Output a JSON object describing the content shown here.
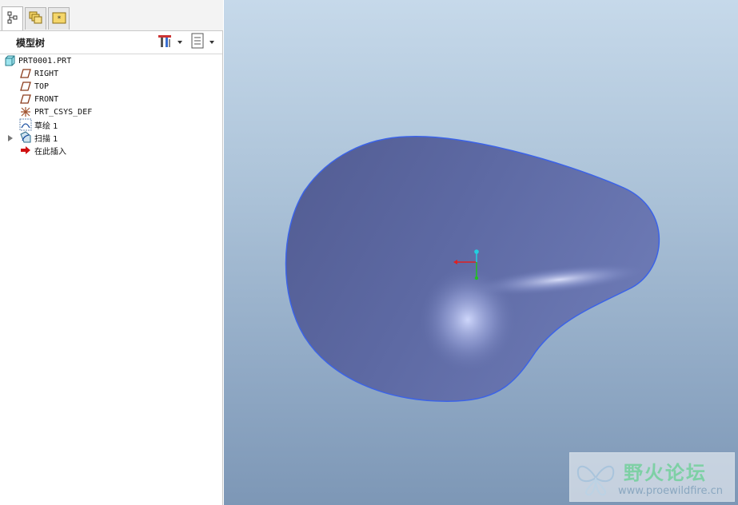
{
  "panel": {
    "tabs": [
      {
        "name": "model-tree-tab",
        "icon": "model-tree-icon",
        "active": true
      },
      {
        "name": "folder-browser-tab",
        "icon": "folder-browser-icon",
        "active": false
      },
      {
        "name": "favorites-tab",
        "icon": "favorites-icon",
        "active": false
      }
    ],
    "header_title": "模型树",
    "settings_icon": "tools-settings-icon",
    "show_icon": "show-list-icon"
  },
  "tree": {
    "root": "PRT0001.PRT",
    "items": [
      {
        "label": "RIGHT",
        "icon": "datum-plane-icon"
      },
      {
        "label": "TOP",
        "icon": "datum-plane-icon"
      },
      {
        "label": "FRONT",
        "icon": "datum-plane-icon"
      },
      {
        "label": "PRT_CSYS_DEF",
        "icon": "coordinate-system-icon"
      },
      {
        "label": "草绘 1",
        "icon": "sketch-icon"
      },
      {
        "label": "扫描 1",
        "icon": "sweep-icon",
        "expandable": true
      },
      {
        "label": "在此插入",
        "icon": "insert-here-arrow-icon"
      }
    ]
  },
  "viewport": {
    "background_top": "#c6d9ea",
    "background_bottom": "#7d97b6",
    "model_color": "#5d6aa4",
    "model_edge_color": "#3a5fe0",
    "axis_colors": {
      "x": "#e02020",
      "y": "#20c020",
      "z": "#20d0e0"
    }
  },
  "watermark": {
    "title": "野火论坛",
    "url": "www.proewildfire.cn"
  }
}
